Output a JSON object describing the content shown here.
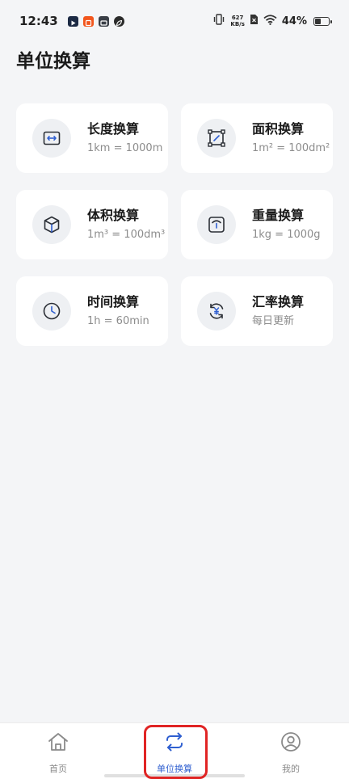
{
  "status_bar": {
    "time": "12:43",
    "net_speed_value": "627",
    "net_speed_unit": "KB/s",
    "battery": "44%"
  },
  "page": {
    "title": "单位换算"
  },
  "cards": [
    {
      "title": "长度换算",
      "subtitle": "1km = 1000m",
      "icon": "length-icon"
    },
    {
      "title": "面积换算",
      "subtitle": "1m² = 100dm²",
      "icon": "area-icon"
    },
    {
      "title": "体积换算",
      "subtitle": "1m³ = 100dm³",
      "icon": "volume-icon"
    },
    {
      "title": "重量换算",
      "subtitle": "1kg = 1000g",
      "icon": "weight-icon"
    },
    {
      "title": "时间换算",
      "subtitle": "1h = 60min",
      "icon": "clock-icon"
    },
    {
      "title": "汇率换算",
      "subtitle": "每日更新",
      "icon": "exchange-rate-icon"
    }
  ],
  "bottom_nav": {
    "items": [
      {
        "label": "首页",
        "icon": "home-icon",
        "active": false
      },
      {
        "label": "单位换算",
        "icon": "convert-icon",
        "active": true
      },
      {
        "label": "我的",
        "icon": "profile-icon",
        "active": false
      }
    ]
  },
  "colors": {
    "accent": "#2f5fd0",
    "background": "#f4f5f7",
    "highlight": "#e02424"
  }
}
